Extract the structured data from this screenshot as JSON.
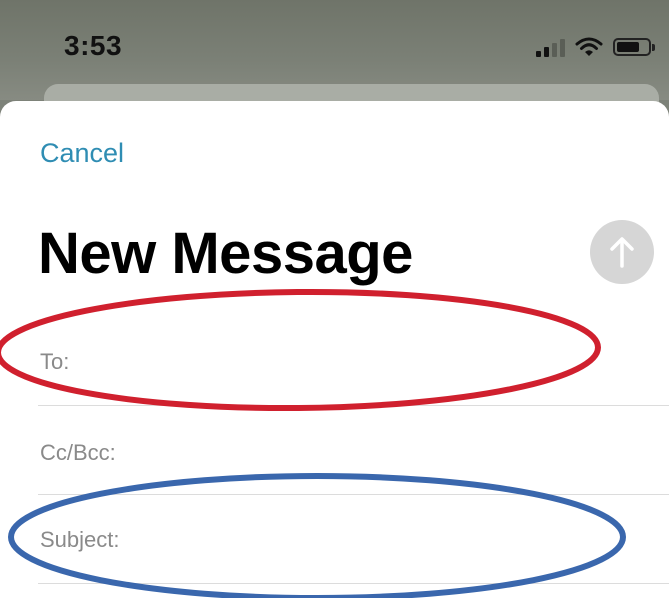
{
  "status_bar": {
    "time": "3:53",
    "icons": [
      "signal-icon",
      "wifi-icon",
      "battery-icon"
    ]
  },
  "compose": {
    "cancel_label": "Cancel",
    "title": "New Message",
    "send_icon": "arrow-up-icon",
    "fields": {
      "to_label": "To:",
      "to_value": "",
      "cc_bcc_label": "Cc/Bcc:",
      "cc_bcc_value": "",
      "subject_label": "Subject:",
      "subject_value": ""
    }
  },
  "annotations": {
    "to_ring_color": "#d0202e",
    "subject_ring_color": "#3a67ad"
  },
  "colors": {
    "link": "#2f8db3",
    "send_button_disabled": "#d6d6d6",
    "label_gray": "#8a8a8a"
  }
}
